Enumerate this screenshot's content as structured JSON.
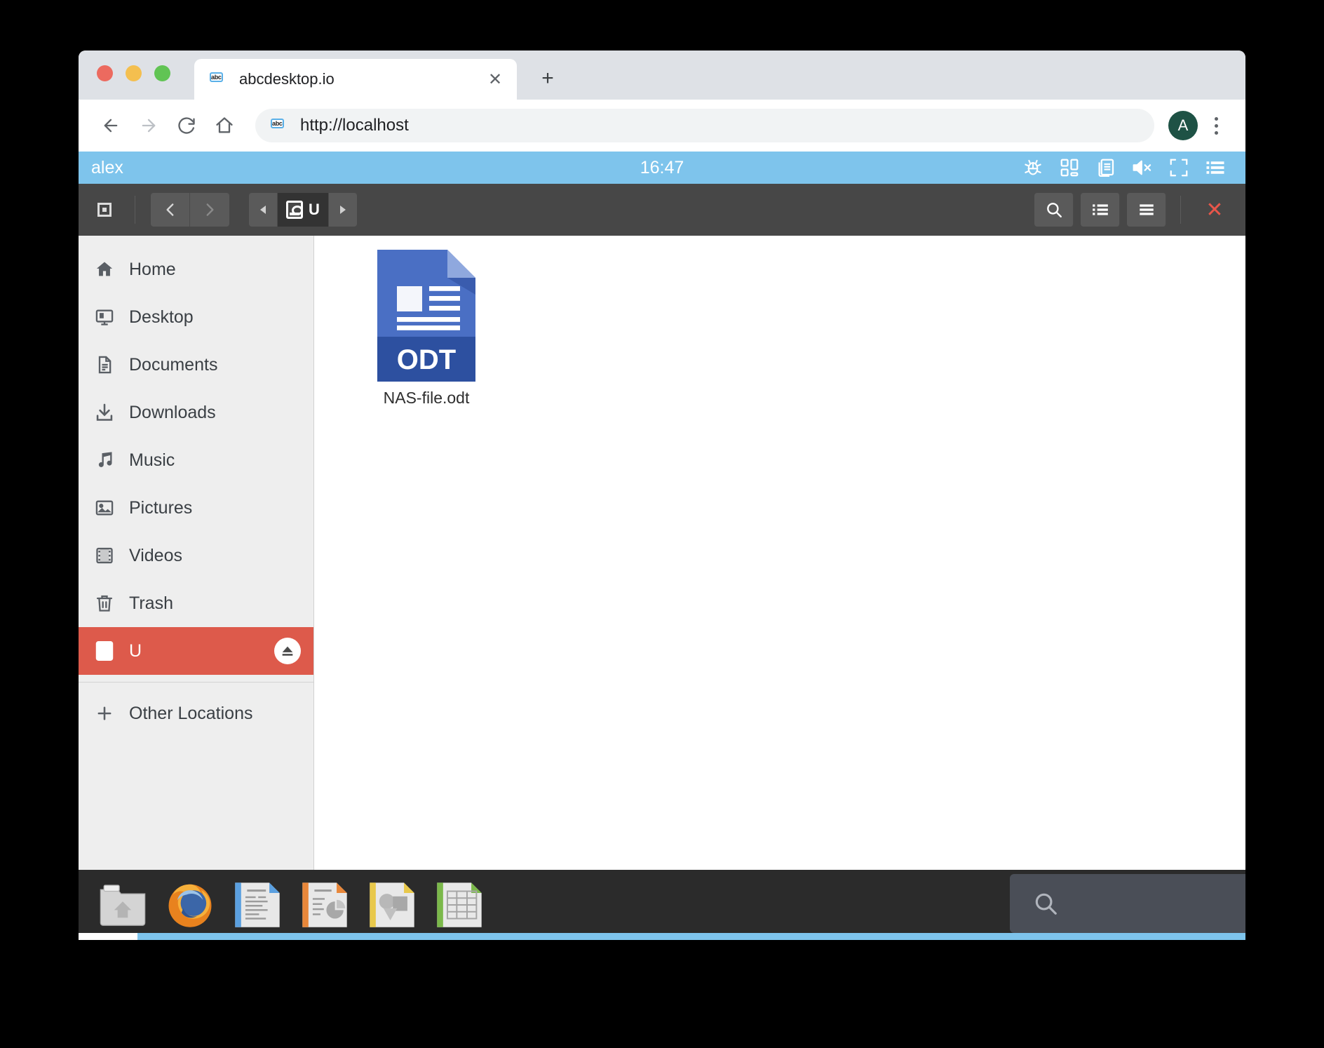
{
  "browser": {
    "tab": {
      "title": "abcdesktop.io",
      "favicon": "abc-monitor-icon",
      "close_label": "✕"
    },
    "new_tab_label": "+",
    "nav": {
      "back": "back-arrow-icon",
      "forward": "forward-arrow-icon",
      "reload": "reload-icon",
      "home": "home-icon"
    },
    "omnibox": {
      "url": "http://localhost",
      "favicon": "abc-monitor-icon"
    },
    "profile": {
      "initial": "A",
      "color": "#1e5245"
    },
    "menu_label": "chrome-menu-icon"
  },
  "desktop": {
    "user": "alex",
    "clock": "16:47",
    "accent_blue": "#7ec4ec",
    "topbar_icons": [
      {
        "name": "bug-icon",
        "label": "Report a bug"
      },
      {
        "name": "apps-grid-icon",
        "label": "Applications"
      },
      {
        "name": "documents-icon",
        "label": "Documents"
      },
      {
        "name": "volume-mute-icon",
        "label": "Muted"
      },
      {
        "name": "fullscreen-icon",
        "label": "Fullscreen"
      },
      {
        "name": "menu-list-icon",
        "label": "Menu"
      }
    ]
  },
  "filemanager": {
    "toolbar": {
      "view_square": "view-square-icon",
      "back": "chevron-left-icon",
      "forward": "chevron-right-icon",
      "crumb_prev": "triangle-left-icon",
      "crumb_next": "triangle-right-icon",
      "current_location": "U",
      "current_location_icon": "drive-icon",
      "search": "search-icon",
      "list_view": "list-view-icon",
      "menu": "hamburger-menu-icon",
      "close": "✕"
    },
    "sidebar": {
      "items": [
        {
          "label": "Home",
          "icon": "home-icon",
          "selected": false
        },
        {
          "label": "Desktop",
          "icon": "desktop-monitor-icon",
          "selected": false
        },
        {
          "label": "Documents",
          "icon": "document-icon",
          "selected": false
        },
        {
          "label": "Downloads",
          "icon": "download-icon",
          "selected": false
        },
        {
          "label": "Music",
          "icon": "music-note-icon",
          "selected": false
        },
        {
          "label": "Pictures",
          "icon": "picture-icon",
          "selected": false
        },
        {
          "label": "Videos",
          "icon": "film-icon",
          "selected": false
        },
        {
          "label": "Trash",
          "icon": "trash-icon",
          "selected": false
        },
        {
          "label": "U",
          "icon": "drive-icon",
          "selected": true,
          "eject": "eject-icon"
        }
      ],
      "other_locations": {
        "label": "Other Locations",
        "icon": "plus-icon"
      },
      "selected_color": "#dd5a4b"
    },
    "files": [
      {
        "name": "NAS-file.odt",
        "type": "ODT",
        "badge": "ODT"
      }
    ]
  },
  "taskbar": {
    "items": [
      {
        "name": "file-manager-icon",
        "label": "Files"
      },
      {
        "name": "firefox-icon",
        "label": "Firefox"
      },
      {
        "name": "libreoffice-writer-icon",
        "label": "LibreOffice Writer"
      },
      {
        "name": "libreoffice-impress-icon",
        "label": "LibreOffice Impress"
      },
      {
        "name": "libreoffice-draw-icon",
        "label": "LibreOffice Draw"
      },
      {
        "name": "libreoffice-calc-icon",
        "label": "LibreOffice Calc"
      }
    ],
    "search": {
      "icon": "search-icon",
      "value": "",
      "placeholder": ""
    }
  }
}
